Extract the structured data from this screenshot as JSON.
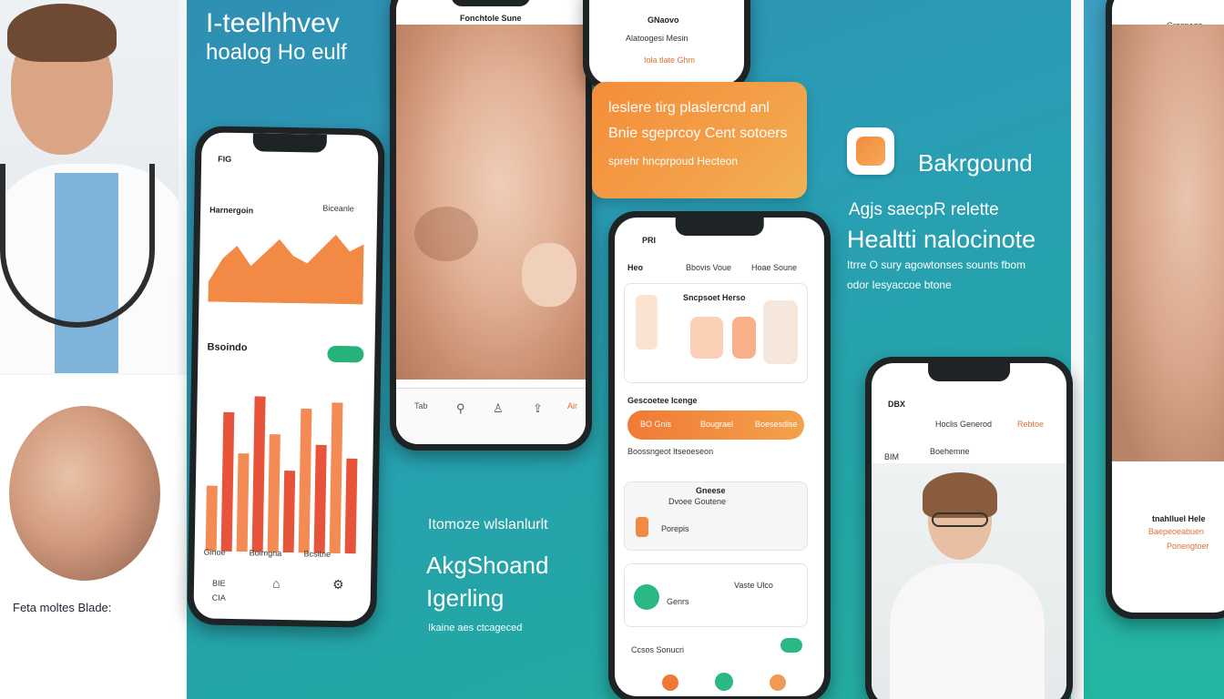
{
  "hero": {
    "title": "I-teelhhvev",
    "subtitle": "hoalog  Ho eulf"
  },
  "left_panel": {
    "caption": "Feta moltes Blade:"
  },
  "phone1": {
    "status": "FIG",
    "header_left": "Harnergoin",
    "header_right": "Biceanle",
    "section_title": "Bsoindo",
    "pill_label": "",
    "footer_left_a": "Ginoe",
    "footer_left_b": "Boimgna",
    "footer_right": "Bcsitne",
    "tab_a": "BIE",
    "tab_b": "CIA",
    "chart_area": [
      22,
      48,
      62,
      40,
      55,
      70,
      52,
      44,
      60,
      76,
      58,
      66
    ],
    "chart_bars": [
      40,
      85,
      60,
      95,
      72,
      50,
      88,
      66,
      92,
      58
    ]
  },
  "phone2": {
    "header": "Fonchtole Sune",
    "tab_a": "Tab",
    "tab_b": "Air"
  },
  "phone3": {
    "title": "GNaovo",
    "subtitle": "Alatoogesi Mesin",
    "line": "Iola  tlate  Ghm"
  },
  "promo": {
    "line1": "leslere  tirg  plaslercnd  anl",
    "line2": "Bnie  sgeprcoy  Cent  sotoers",
    "line3": "sprehr  hncprpoud  Hecteon"
  },
  "phone4": {
    "status": "PRI",
    "row1_left": "Heo",
    "row1_mid": "Bbovis  Voue",
    "row1_right": "Hoae  Soune",
    "card_title": "Sncpsoet  Herso",
    "section": "Gescoetee  Icenge",
    "orange_left": "BO  Gnis",
    "orange_mid": "Bougrael",
    "orange_right": "Boesesdise",
    "line_a": "Boossngeot  Itseoeseon",
    "box_title": "Gneese",
    "box_sub": "Dvoee  Goutene",
    "box_row": "Porepis",
    "row3_a": "Genrs",
    "row3_b": "Vaste  Ulco",
    "row4": "Ccsos  Sonucri"
  },
  "phone5": {
    "status": "DBX",
    "header_mid": "Hoclis  Generod",
    "header_right": "Rebtoe",
    "sub": "Boehemne",
    "tab": "BIM"
  },
  "phone6": {
    "header": "Grespoge",
    "line_a": "tnahlluel  Hele",
    "line_b": "Baepeoeabuen",
    "line_c": "Ponengtoer"
  },
  "right_block": {
    "brand": "Bakrgound",
    "line1": "Agjs  saecpR  relette",
    "line2": "Healtti  nalocinote",
    "para1": "Itrre  O  sury  agowtonses  sounts  fbom",
    "para2": "odor  Iesyaccoe  btone"
  },
  "mid_block": {
    "tag": "Itomoze  wlslanlurlt",
    "title1": "AkgShoand",
    "title2": "Igerling",
    "small": "Ikaine  aes  ctcageced"
  },
  "colors": {
    "teal": "#23a6a6",
    "orange": "#f07a35",
    "green": "#2ab885"
  }
}
